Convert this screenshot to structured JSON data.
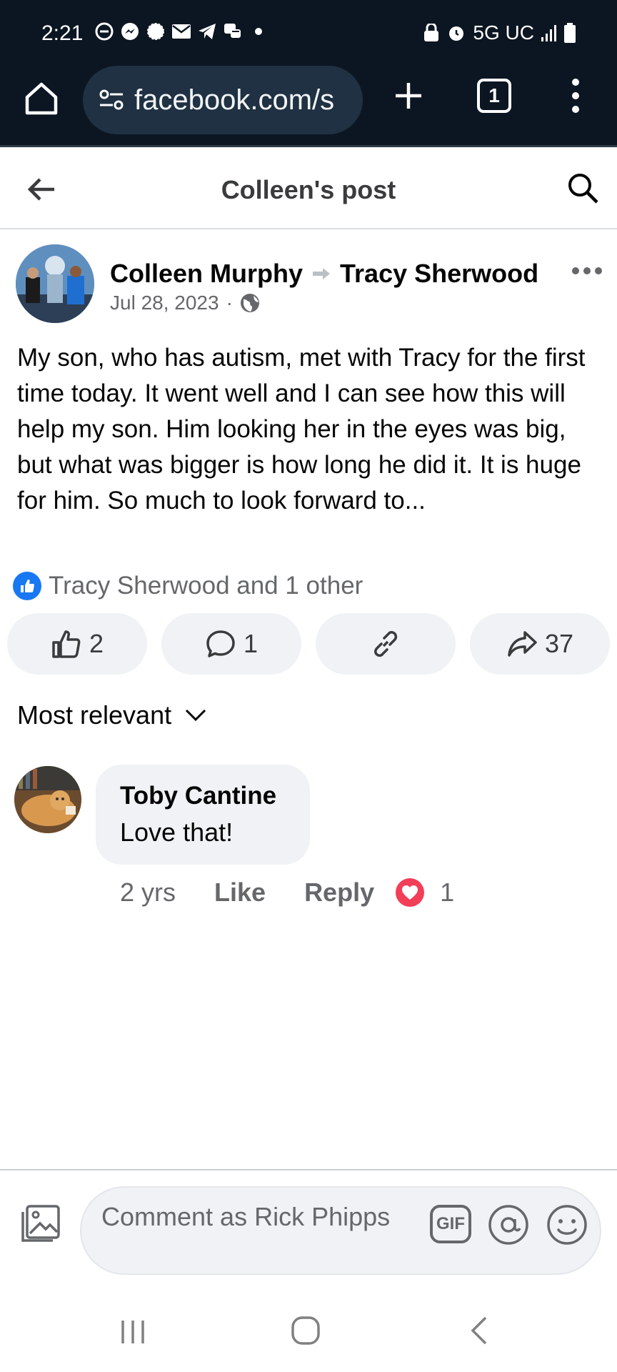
{
  "status": {
    "time": "2:21",
    "network": "5G UC",
    "left_icons": [
      "do-not-disturb-icon",
      "messenger-icon",
      "signal-icon",
      "mail-icon",
      "telegram-icon",
      "chat-icon",
      "dot-icon"
    ],
    "right_icons": [
      "lock-icon",
      "alarm-icon",
      "signal-bars-icon",
      "battery-icon"
    ]
  },
  "browser": {
    "url": "facebook.com/s",
    "tab_count": "1"
  },
  "header": {
    "title": "Colleen's post"
  },
  "post": {
    "author": "Colleen Murphy",
    "recipient": "Tracy Sherwood",
    "date": "Jul 28, 2023",
    "separator": "·",
    "audience_icon": "globe-icon",
    "body": "My son, who has autism, met with Tracy for the first time today.  It went well and I can see how this will help my son.  Him looking her in the eyes was big, but what was bigger is how long he did it.  It is huge for him.  So much to look forward to...",
    "reactions_summary": "Tracy Sherwood and 1 other",
    "actions": {
      "like_count": "2",
      "comment_count": "1",
      "share_count": "37"
    },
    "colors": {
      "like_blue": "#1877f2",
      "love_red": "#f33e58"
    }
  },
  "comments": {
    "sort_label": "Most relevant",
    "items": [
      {
        "author": "Toby Cantine",
        "text": "Love that!",
        "time": "2 yrs",
        "like_label": "Like",
        "reply_label": "Reply",
        "reaction_count": "1"
      }
    ]
  },
  "composer": {
    "placeholder": "Comment as Rick Phipps",
    "gif_label": "GIF"
  }
}
